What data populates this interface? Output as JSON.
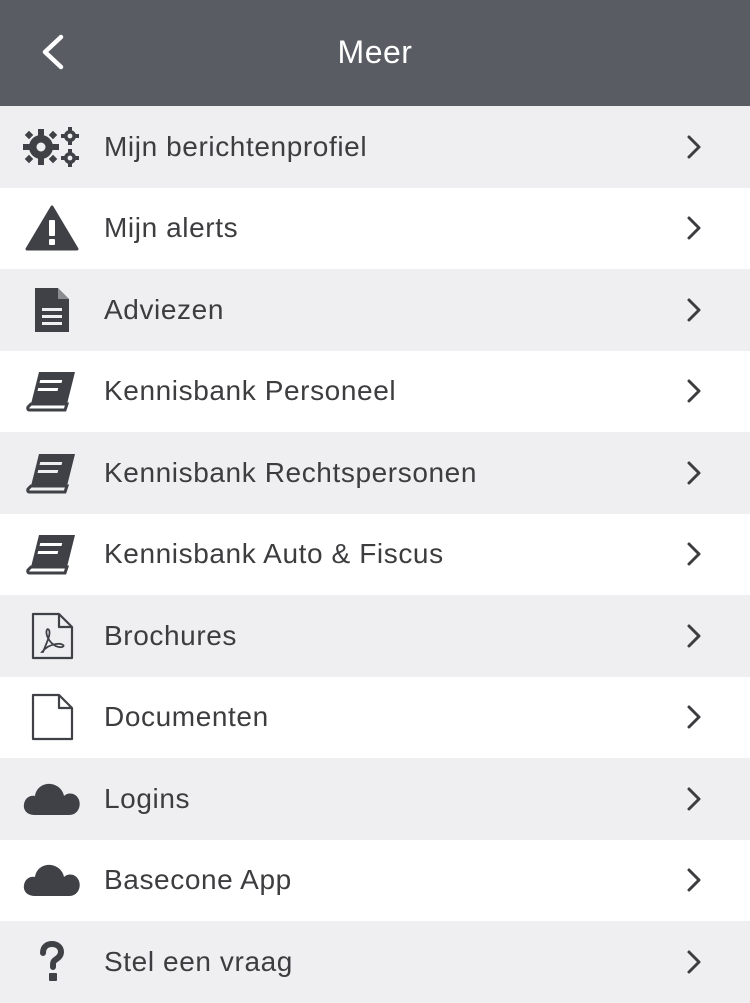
{
  "header": {
    "title": "Meer"
  },
  "menu": {
    "items": [
      {
        "label": "Mijn berichtenprofiel",
        "icon": "gears-icon"
      },
      {
        "label": "Mijn alerts",
        "icon": "warning-icon"
      },
      {
        "label": "Adviezen",
        "icon": "document-icon"
      },
      {
        "label": "Kennisbank Personeel",
        "icon": "book-icon"
      },
      {
        "label": "Kennisbank Rechtspersonen",
        "icon": "book-icon"
      },
      {
        "label": "Kennisbank Auto & Fiscus",
        "icon": "book-icon"
      },
      {
        "label": "Brochures",
        "icon": "pdf-file-icon"
      },
      {
        "label": "Documenten",
        "icon": "file-outline-icon"
      },
      {
        "label": "Logins",
        "icon": "cloud-icon"
      },
      {
        "label": "Basecone App",
        "icon": "cloud-icon"
      },
      {
        "label": "Stel een vraag",
        "icon": "question-icon"
      }
    ]
  },
  "colors": {
    "header_bg": "#595c62",
    "row_alt_bg": "#efeff1",
    "text": "#3d3d40",
    "icon": "#3f4146"
  }
}
